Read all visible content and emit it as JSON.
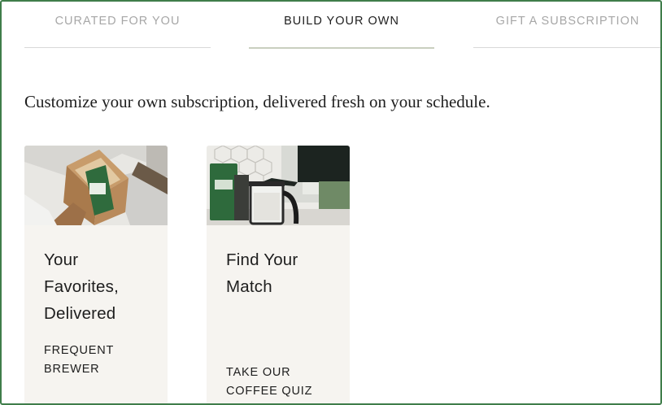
{
  "tabs": [
    {
      "label": "CURATED FOR YOU",
      "state": "inactive"
    },
    {
      "label": "BUILD YOUR OWN",
      "state": "active"
    },
    {
      "label": "GIFT A SUBSCRIPTION",
      "state": "inactive"
    }
  ],
  "intro": "Customize your own subscription, delivered fresh on your schedule.",
  "cards": [
    {
      "title": "Your Favorites, Delivered",
      "cta": "FREQUENT BREWER",
      "image": "coffee-box-photo"
    },
    {
      "title": "Find Your Match",
      "cta": "TAKE OUR COFFEE QUIZ",
      "image": "french-press-photo"
    }
  ],
  "colors": {
    "frame": "#3f7d4a",
    "card_bg": "#f6f4f0",
    "active_text": "#1e1e1e",
    "inactive_text": "#a7a7a7"
  }
}
